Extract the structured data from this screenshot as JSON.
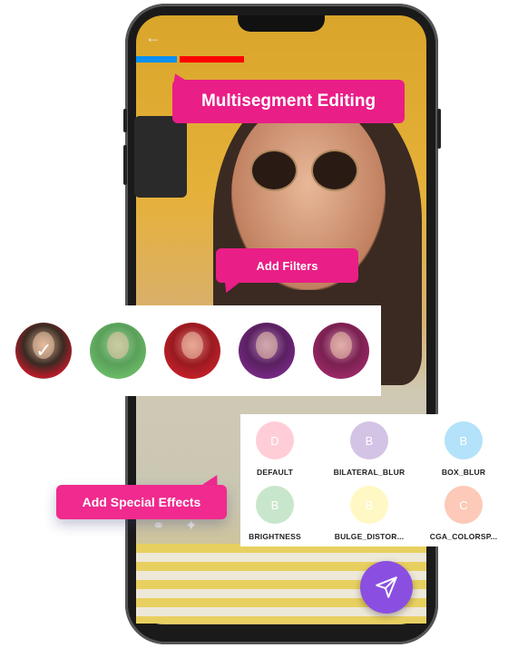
{
  "colors": {
    "accent": "#e91e86",
    "segment_1": "#0a90f5",
    "segment_2": "#ff0000",
    "fab": "#8a4fe0"
  },
  "header": {
    "back_icon": "arrow-left-icon"
  },
  "segments": [
    {
      "color": "#0a90f5"
    },
    {
      "color": "#ff0000"
    }
  ],
  "callouts": {
    "multisegment": "Multisegment Editing",
    "filters": "Add Filters",
    "effects": "Add Special Effects"
  },
  "filters": [
    {
      "name": "original",
      "tint": "none",
      "selected": true
    },
    {
      "name": "green",
      "tint": "#6cbf6a"
    },
    {
      "name": "red",
      "tint": "#c8202a"
    },
    {
      "name": "purple",
      "tint": "#7a2a8a"
    },
    {
      "name": "magenta",
      "tint": "#a02a6a"
    }
  ],
  "effects": [
    {
      "letter": "D",
      "label": "DEFAULT",
      "color": "#ffcdd6"
    },
    {
      "letter": "B",
      "label": "BILATERAL_BLUR",
      "color": "#d3c4e6"
    },
    {
      "letter": "B",
      "label": "BOX_BLUR",
      "color": "#b3e2fa"
    },
    {
      "letter": "B",
      "label": "BRIGHTNESS",
      "color": "#c8e6cb"
    },
    {
      "letter": "B",
      "label": "BULGE_DISTOR...",
      "color": "#fff8c4"
    },
    {
      "letter": "C",
      "label": "CGA_COLORSP...",
      "color": "#fdc9b8"
    }
  ],
  "toolbar": {
    "filter_icon": "overlapping-circles-icon",
    "effects_icon": "magic-wand-icon"
  },
  "fab": {
    "icon": "send-icon"
  }
}
